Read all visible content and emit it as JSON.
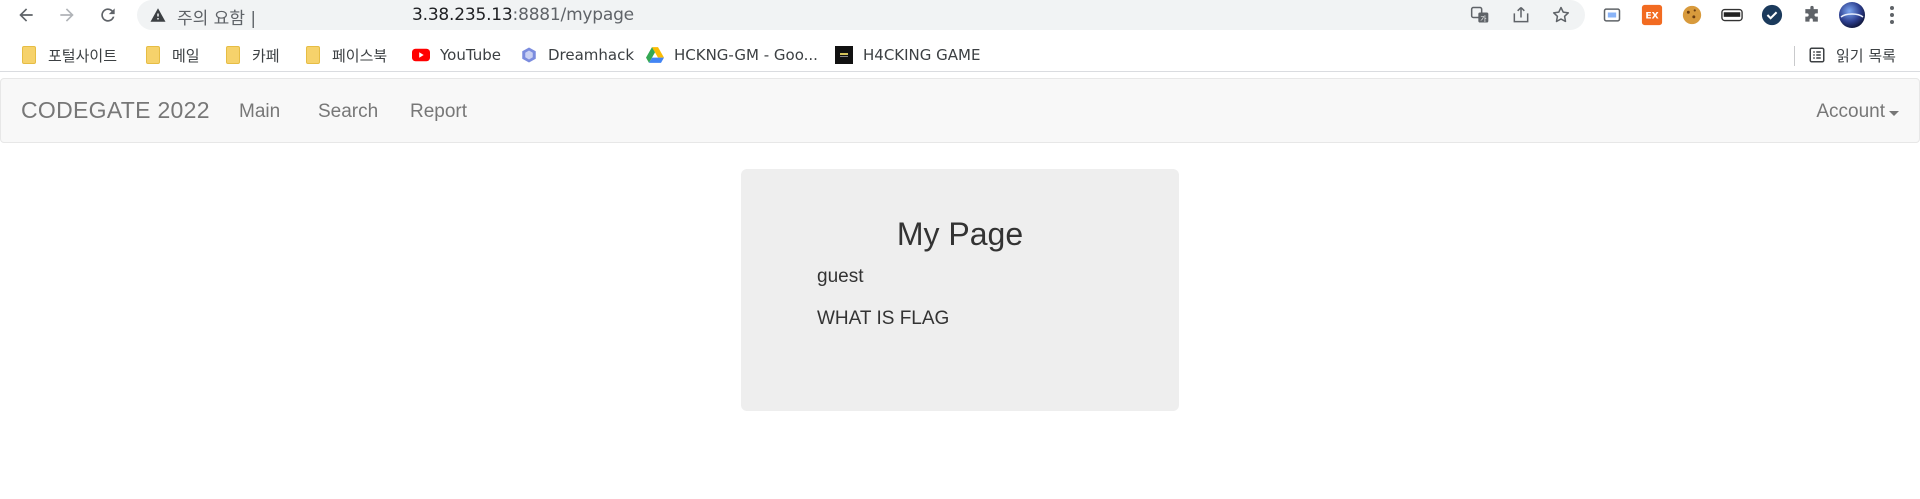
{
  "browser": {
    "warning_text": "주의 요함 |",
    "url_host": "3.38.235.13",
    "url_path": ":8881/mypage",
    "icons": {
      "back": "arrow-left-icon",
      "forward": "arrow-right-icon",
      "reload": "reload-icon",
      "warning": "warning-icon",
      "translate": "translate-icon",
      "share": "share-icon",
      "bookmark_star": "star-icon"
    },
    "extensions": [
      {
        "name": "cast-ext-icon",
        "label": ""
      },
      {
        "name": "ex-ext-icon",
        "label": "EX",
        "color": "#f26b21"
      },
      {
        "name": "cookie-ext-icon",
        "label": ""
      },
      {
        "name": "mask-ext-icon",
        "label": ""
      },
      {
        "name": "check-ext-icon",
        "label": "",
        "color": "#1b3a5c"
      },
      {
        "name": "puzzle-icon",
        "label": ""
      },
      {
        "name": "profile-avatar",
        "label": ""
      },
      {
        "name": "menu-dots-icon",
        "label": ""
      }
    ]
  },
  "bookmarks": [
    {
      "label": "포털사이트",
      "icon": "folder-icon"
    },
    {
      "label": "메일",
      "icon": "folder-icon"
    },
    {
      "label": "카페",
      "icon": "folder-icon"
    },
    {
      "label": "페이스북",
      "icon": "folder-icon"
    },
    {
      "label": "YouTube",
      "icon": "youtube-icon"
    },
    {
      "label": "Dreamhack",
      "icon": "dreamhack-icon"
    },
    {
      "label": "HCKNG-GM - Goo...",
      "icon": "google-drive-icon"
    },
    {
      "label": "H4CKING GAME",
      "icon": "h4cking-game-icon"
    }
  ],
  "reading_list": {
    "label": "읽기 목록",
    "icon": "reading-list-icon"
  },
  "navbar": {
    "brand": "CODEGATE 2022",
    "links": [
      "Main",
      "Search",
      "Report"
    ],
    "account": "Account"
  },
  "card": {
    "title": "My Page",
    "username": "guest",
    "memo": "WHAT IS FLAG"
  },
  "colors": {
    "navbar_bg": "#f8f8f8",
    "card_bg": "#eeeeee",
    "link_text": "#777777",
    "youtube_red": "#ff0000"
  }
}
